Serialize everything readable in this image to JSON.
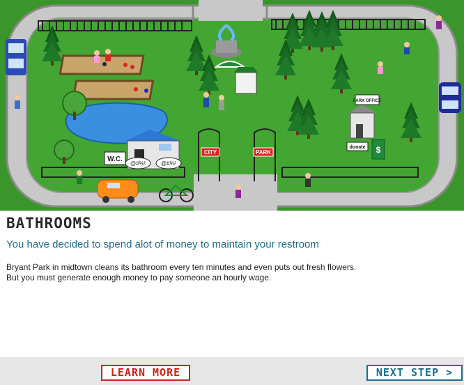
{
  "scene": {
    "signs": {
      "restroom": "W.C.",
      "gate_left": "CITY",
      "gate_right": "PARK",
      "office": "PARK OFFICE",
      "donate": "donate",
      "dollar": "$"
    },
    "speech_bubbles": [
      "@#%!",
      "@#%!"
    ]
  },
  "topic": {
    "heading": "BATHROOMS",
    "decision": "You have decided to spend alot of money to maintain your restroom",
    "description": "Bryant Park in midtown cleans its bathroom every ten minutes and even puts out fresh flowers. But you must generate enough money to pay someone an hourly wage."
  },
  "footer": {
    "learn_more_label": "LEARN MORE",
    "next_step_label": "NEXT STEP >"
  },
  "colors": {
    "grass": "#3e9b2e",
    "path": "#d5d5d5",
    "pond": "#3b8fe0",
    "heading": "#2a2a2a",
    "decision_text": "#1a6c8a",
    "learn_more": "#d0201a",
    "next_step": "#1a6f8c"
  }
}
